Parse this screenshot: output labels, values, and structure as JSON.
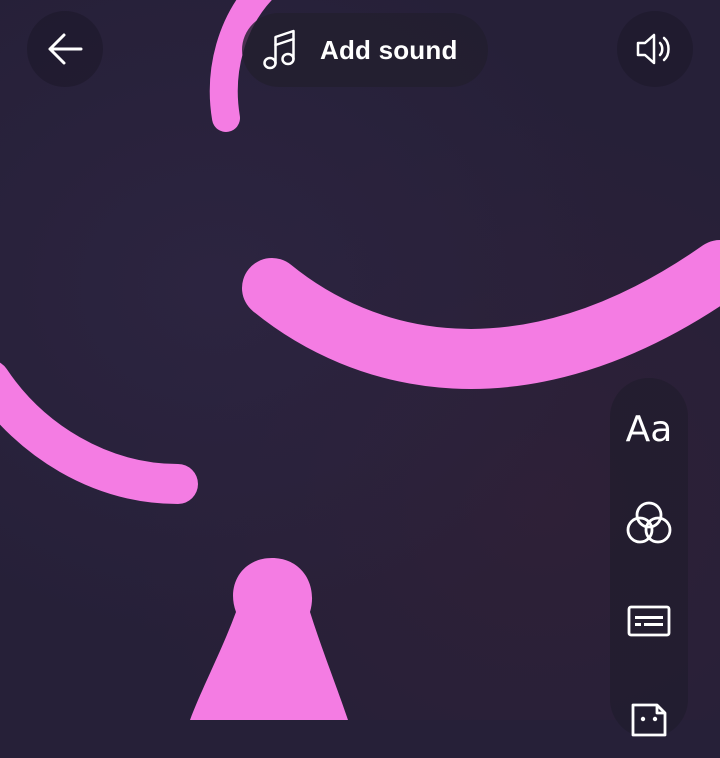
{
  "header": {
    "sound_label": "Add sound"
  },
  "icons": {
    "back": "arrow-left-icon",
    "music": "music-note-icon",
    "volume": "speaker-icon",
    "filters": "overlapping-circles-icon",
    "captions": "captions-icon",
    "sticker": "sticker-icon"
  },
  "tools": {
    "text_label": "Aa"
  },
  "colors": {
    "background": "#262038",
    "drawing_stroke": "#f47ce3",
    "overlay": "#1c1828",
    "icon": "#ffffff"
  }
}
